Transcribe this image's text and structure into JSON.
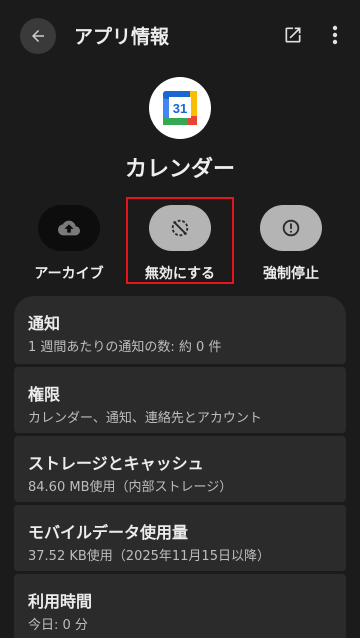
{
  "header": {
    "title": "アプリ情報",
    "back_icon": "back-arrow-icon",
    "open_icon": "open-in-new-icon",
    "more_icon": "more-vertical-icon"
  },
  "app": {
    "name": "カレンダー",
    "icon_text": "31"
  },
  "actions": [
    {
      "label": "アーカイブ",
      "icon": "cloud-upload-icon"
    },
    {
      "label": "無効にする",
      "icon": "disable-icon"
    },
    {
      "label": "強制停止",
      "icon": "alert-icon"
    }
  ],
  "settings": [
    {
      "title": "通知",
      "subtitle": "1 週間あたりの通知の数: 約 0 件"
    },
    {
      "title": "権限",
      "subtitle": "カレンダー、通知、連絡先とアカウント"
    },
    {
      "title": "ストレージとキャッシュ",
      "subtitle": "84.60 MB使用（内部ストレージ）"
    },
    {
      "title": "モバイルデータ使用量",
      "subtitle": "37.52 KB使用（2025年11月15日以降）"
    },
    {
      "title": "利用時間",
      "subtitle": "今日: 0 分"
    }
  ],
  "colors": {
    "background": "#1b1b1b",
    "card": "#2b2b2b",
    "highlight": "#e8141b"
  }
}
